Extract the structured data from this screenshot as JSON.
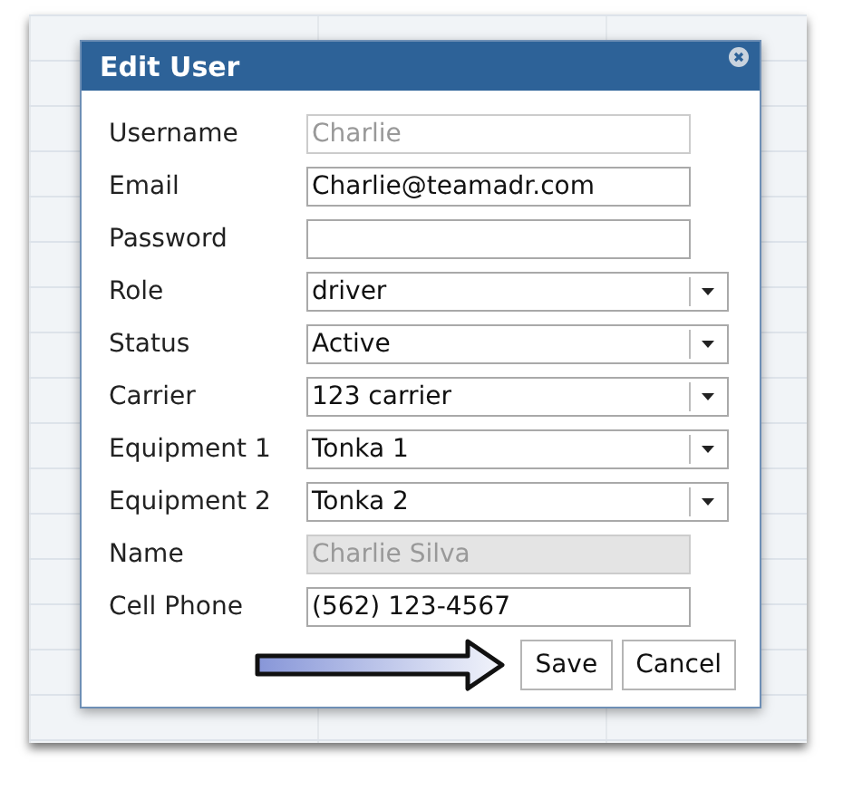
{
  "dialog": {
    "title": "Edit User"
  },
  "fields": [
    {
      "label": "Username",
      "kind": "readonly",
      "value": "Charlie"
    },
    {
      "label": "Email",
      "kind": "text",
      "value": "Charlie@teamadr.com"
    },
    {
      "label": "Password",
      "kind": "text"
    },
    {
      "label": "Role",
      "kind": "select",
      "value": "driver"
    },
    {
      "label": "Status",
      "kind": "select",
      "value": "Active"
    },
    {
      "label": "Carrier",
      "kind": "select",
      "value": "123 carrier"
    },
    {
      "label": "Equipment 1",
      "kind": "select",
      "value": "Tonka 1"
    },
    {
      "label": "Equipment 2",
      "kind": "select",
      "value": "Tonka 2"
    },
    {
      "label": "Name",
      "kind": "disabled",
      "value": "Charlie Silva"
    },
    {
      "label": "Cell Phone",
      "kind": "text",
      "value": "(562) 123-4567"
    }
  ],
  "buttons": [
    "Save",
    "Cancel"
  ]
}
